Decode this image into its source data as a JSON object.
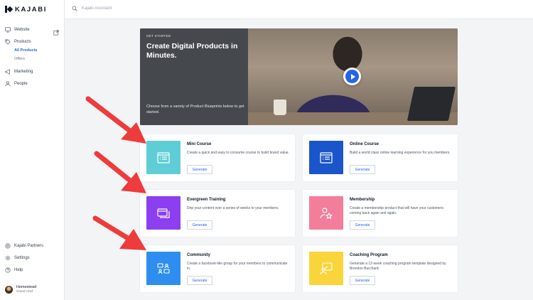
{
  "app": {
    "logo_text": "KAJABI"
  },
  "search": {
    "placeholder": "Kajabi Assistant"
  },
  "sidebar": {
    "items": [
      {
        "label": "Website",
        "icon": "monitor-icon"
      },
      {
        "label": "Products",
        "icon": "tag-icon"
      },
      {
        "label": "Marketing",
        "icon": "megaphone-icon"
      },
      {
        "label": "People",
        "icon": "person-icon"
      }
    ],
    "sub_items": [
      {
        "label": "All Products",
        "active": true
      },
      {
        "label": "Offers",
        "active": false
      }
    ],
    "footer_items": [
      {
        "label": "Kajabi Partners",
        "icon": "partners-icon"
      },
      {
        "label": "Settings",
        "icon": "gear-icon"
      },
      {
        "label": "Help",
        "icon": "help-icon"
      }
    ],
    "user": {
      "name": "Homestead",
      "role": "Grand Chef"
    }
  },
  "hero": {
    "eyebrow": "GET STARTED",
    "title": "Create Digital Products in Minutes.",
    "description": "Choose from a variety of Product Blueprints below to get started."
  },
  "cards": [
    {
      "title": "Mini Course",
      "description": "Create a quick and easy to consume course to build brand value.",
      "button": "Generate",
      "color": "#5ecdd6",
      "icon": "course-list-icon"
    },
    {
      "title": "Online Course",
      "description": "Build a world class online learning experience for you members.",
      "button": "Generate",
      "color": "#1a56c9",
      "icon": "course-list-icon"
    },
    {
      "title": "Evergreen Training",
      "description": "Drip your content over a series of weeks to your members.",
      "button": "Generate",
      "color": "#8b3ff0",
      "icon": "stacked-windows-icon"
    },
    {
      "title": "Membership",
      "description": "Create a membership product that will have your customers coming back again and again.",
      "button": "Generate",
      "color": "#f37e99",
      "icon": "member-star-icon"
    },
    {
      "title": "Community",
      "description": "Create a facebook-like group for your members to communicate in.",
      "button": "Generate",
      "color": "#2e8ef0",
      "icon": "chat-people-icon"
    },
    {
      "title": "Coaching Program",
      "description": "Generate a 12-week coaching program template designed by Brendon Burchard.",
      "button": "Generate",
      "color": "#fad43b",
      "icon": "coach-board-icon"
    }
  ],
  "accent_color": "#2563eb",
  "arrow_color": "#ee3b3b"
}
